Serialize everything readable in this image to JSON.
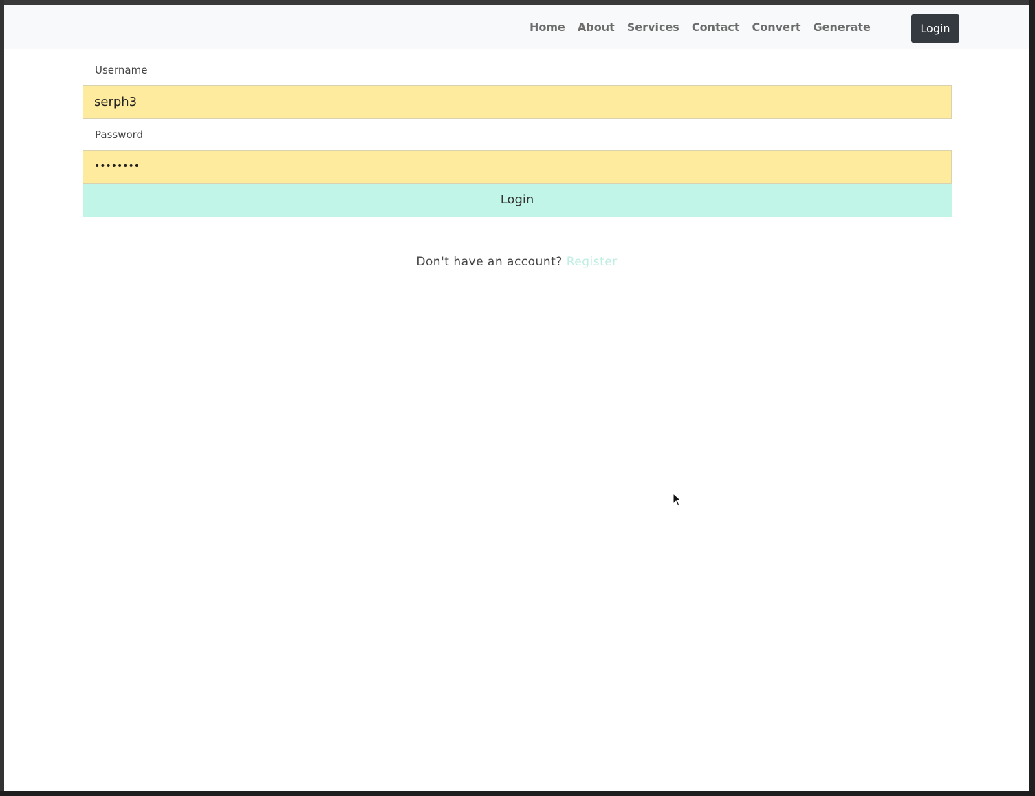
{
  "nav": {
    "links": [
      "Home",
      "About",
      "Services",
      "Contact",
      "Convert",
      "Generate"
    ],
    "login_label": "Login"
  },
  "form": {
    "username_label": "Username",
    "username_value": "serph3",
    "password_label": "Password",
    "password_value": "••••••••",
    "submit_label": "Login"
  },
  "register": {
    "prompt": "Don't have an account?",
    "link_label": "Register"
  },
  "colors": {
    "navbar_bg": "#f8f9fa",
    "input_autofill_bg": "#ffeb9e",
    "login_button_bg": "#c1f5e8",
    "nav_login_bg": "#343a40",
    "register_link": "#bfeee2"
  }
}
